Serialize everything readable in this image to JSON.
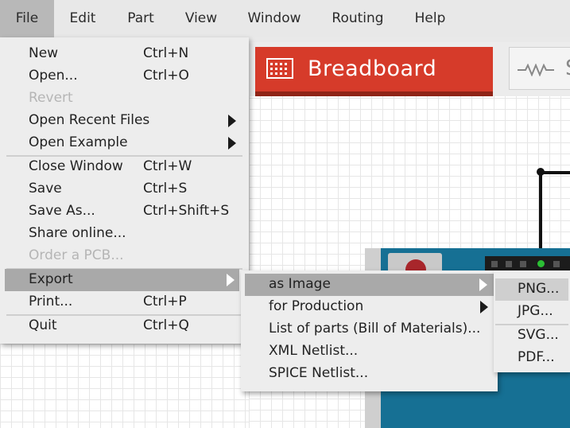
{
  "menubar": {
    "items": [
      {
        "label": "File"
      },
      {
        "label": "Edit"
      },
      {
        "label": "Part"
      },
      {
        "label": "View"
      },
      {
        "label": "Window"
      },
      {
        "label": "Routing"
      },
      {
        "label": "Help"
      }
    ]
  },
  "tabs": {
    "breadboard": {
      "label": "Breadboard",
      "icon": "breadboard-icon",
      "color": "#d63b2a"
    },
    "schematic": {
      "label": "S",
      "icon": "resistor-icon"
    }
  },
  "file_menu": {
    "items": [
      {
        "label": "New",
        "shortcut": "Ctrl+N"
      },
      {
        "label": "Open...",
        "shortcut": "Ctrl+O"
      },
      {
        "label": "Revert",
        "disabled": true
      },
      {
        "label": "Open Recent Files",
        "submenu": true
      },
      {
        "label": "Open Example",
        "submenu": true
      },
      {
        "label": "Close Window",
        "shortcut": "Ctrl+W"
      },
      {
        "label": "Save",
        "shortcut": "Ctrl+S"
      },
      {
        "label": "Save As...",
        "shortcut": "Ctrl+Shift+S"
      },
      {
        "label": "Share online..."
      },
      {
        "label": "Order a PCB...",
        "disabled": true
      },
      {
        "label": "Export",
        "submenu": true,
        "highlighted": true
      },
      {
        "label": "Print...",
        "shortcut": "Ctrl+P"
      },
      {
        "label": "Quit",
        "shortcut": "Ctrl+Q"
      }
    ]
  },
  "export_menu": {
    "items": [
      {
        "label": "as Image",
        "submenu": true,
        "highlighted": true
      },
      {
        "label": "for Production",
        "submenu": true
      },
      {
        "label": "List of parts (Bill of Materials)..."
      },
      {
        "label": "XML Netlist..."
      },
      {
        "label": "SPICE Netlist..."
      }
    ]
  },
  "image_menu": {
    "items": [
      {
        "label": "PNG...",
        "highlighted": true
      },
      {
        "label": "JPG..."
      },
      {
        "label": "SVG..."
      },
      {
        "label": "PDF..."
      }
    ]
  },
  "colors": {
    "menu_bg": "#ededed",
    "highlight": "#a9a9a9",
    "disabled_text": "#b5b5b5",
    "board": "#167094"
  }
}
